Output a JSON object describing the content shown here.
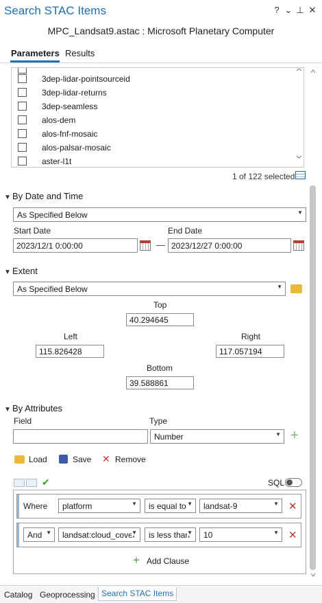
{
  "window": {
    "title": "Search STAC Items",
    "subtitle": "MPC_Landsat9.astac : Microsoft Planetary Computer",
    "controls": {
      "help": "?",
      "menu": "⌄",
      "pin": "⊥",
      "close": "✕"
    }
  },
  "tabs": [
    {
      "label": "Parameters",
      "active": true
    },
    {
      "label": "Results",
      "active": false
    }
  ],
  "collections": {
    "items": [
      {
        "label": "3dep-lidar-pointsourceid",
        "checked": false
      },
      {
        "label": "3dep-lidar-returns",
        "checked": false
      },
      {
        "label": "3dep-seamless",
        "checked": false
      },
      {
        "label": "alos-dem",
        "checked": false
      },
      {
        "label": "alos-fnf-mosaic",
        "checked": false
      },
      {
        "label": "alos-palsar-mosaic",
        "checked": false
      },
      {
        "label": "aster-l1t",
        "checked": false
      }
    ],
    "selected_count": "1 of 122 selected"
  },
  "date_time": {
    "heading": "By Date and Time",
    "mode": "As Specified Below",
    "start_label": "Start Date",
    "start_value": "2023/12/1 0:00:00",
    "end_label": "End Date",
    "end_value": "2023/12/27 0:00:00",
    "separator": "—"
  },
  "extent": {
    "heading": "Extent",
    "mode": "As Specified Below",
    "top_label": "Top",
    "top_value": "40.294645",
    "left_label": "Left",
    "left_value": "115.826428",
    "right_label": "Right",
    "right_value": "117.057194",
    "bottom_label": "Bottom",
    "bottom_value": "39.588861"
  },
  "attributes": {
    "heading": "By Attributes",
    "field_label": "Field",
    "field_value": "",
    "type_label": "Type",
    "type_value": "Number",
    "load_label": "Load",
    "save_label": "Save",
    "remove_label": "Remove",
    "sql_label": "SQL",
    "sql_enabled": false,
    "clauses": [
      {
        "connector": "Where",
        "field": "platform",
        "operator": "is equal to",
        "value": "landsat-9"
      },
      {
        "connector": "And",
        "field": "landsat:cloud_cover",
        "operator": "is less than",
        "value": "10"
      }
    ],
    "add_clause_label": "Add Clause"
  },
  "bottom_tabs": [
    {
      "label": "Catalog",
      "active": false
    },
    {
      "label": "Geoprocessing",
      "active": false
    },
    {
      "label": "Search STAC Items",
      "active": true
    }
  ]
}
